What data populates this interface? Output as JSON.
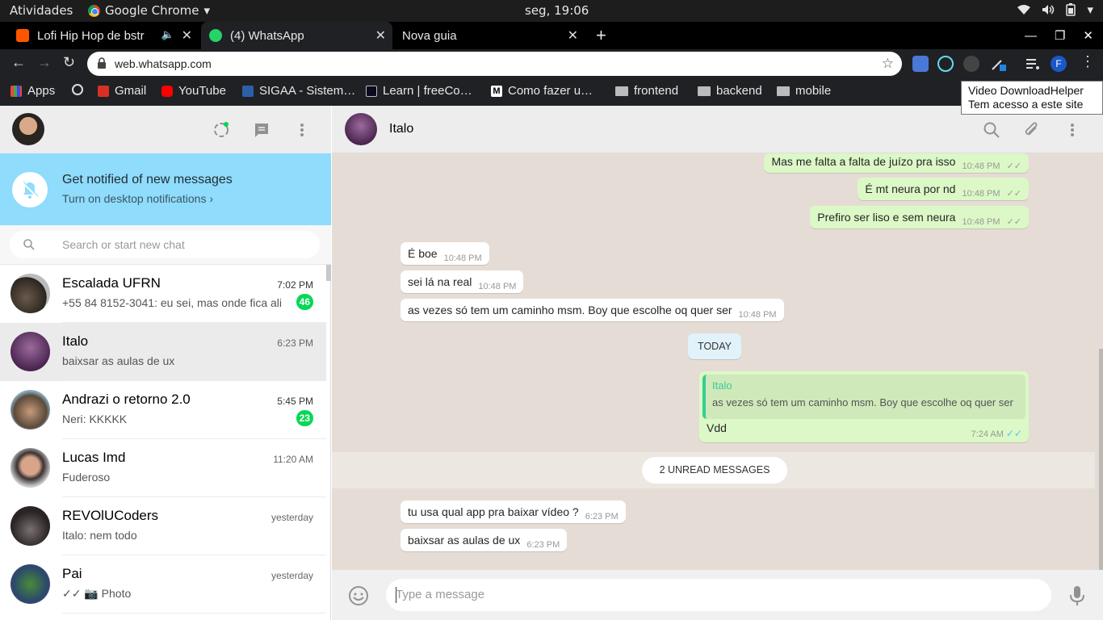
{
  "os": {
    "activities": "Atividades",
    "app_name": "Google Chrome",
    "app_menu_arrow": "▾",
    "clock": "seg, 19:06"
  },
  "tabs": [
    {
      "title": "Lofi Hip Hop de bstr",
      "audio": "🔈",
      "close": "✕",
      "favicon_color": "#ff5500"
    },
    {
      "title": "(4) WhatsApp",
      "close": "✕",
      "favicon_color": "#25d366"
    },
    {
      "title": "Nova guia",
      "close": "✕"
    }
  ],
  "new_tab": "+",
  "window_controls": {
    "minimize": "—",
    "maximize": "❐",
    "close": "✕"
  },
  "toolbar": {
    "back": "←",
    "forward": "→",
    "reload": "↻",
    "url": "web.whatsapp.com",
    "star": "☆",
    "profile_letter": "F",
    "menu": "⋮"
  },
  "bookmarks": [
    {
      "label": "Apps",
      "icon": "apps-grid-icon"
    },
    {
      "label": "",
      "icon": "globe-icon"
    },
    {
      "label": "Gmail",
      "icon": "gmail-icon"
    },
    {
      "label": "YouTube",
      "icon": "youtube-icon"
    },
    {
      "label": "SIGAA - Sistem…",
      "icon": "sigaa-icon"
    },
    {
      "label": "Learn | freeCo…",
      "icon": "freecodecamp-icon"
    },
    {
      "label": "Como fazer u…",
      "icon": "medium-icon"
    },
    {
      "label": "frontend",
      "icon": "folder-icon"
    },
    {
      "label": "backend",
      "icon": "folder-icon"
    },
    {
      "label": "mobile",
      "icon": "folder-icon"
    }
  ],
  "tooltip": {
    "line1": "Video DownloadHelper",
    "line2": "Tem acesso a este site"
  },
  "notify": {
    "title": "Get notified of new messages",
    "subtitle": "Turn on desktop notifications ›"
  },
  "search": {
    "placeholder": "Search or start new chat"
  },
  "chats": [
    {
      "name": "Escalada UFRN",
      "time": "7:02 PM",
      "preview": "+55 84 8152-3041: eu sei, mas onde fica ali",
      "badge": "46",
      "selected": false
    },
    {
      "name": "Italo",
      "time": "6:23 PM",
      "preview": "baixsar as aulas de ux",
      "badge": "",
      "selected": true
    },
    {
      "name": "Andrazi o retorno 2.0",
      "time": "5:45 PM",
      "preview": "Neri: KKKKK",
      "badge": "23",
      "selected": false
    },
    {
      "name": "Lucas Imd",
      "time": "11:20 AM",
      "preview": "Fuderoso",
      "badge": "",
      "selected": false
    },
    {
      "name": "REVOlUCoders",
      "time": "yesterday",
      "preview": "Italo: nem todo",
      "badge": "",
      "selected": false
    },
    {
      "name": "Pai",
      "time": "yesterday",
      "preview": "✓✓ 📷 Photo",
      "badge": "",
      "selected": false
    }
  ],
  "conversation": {
    "contact": "Italo",
    "messages": [
      {
        "dir": "out",
        "text": "Mas me falta a falta de juízo pra isso",
        "time": "10:48 PM",
        "ticks": "✓✓"
      },
      {
        "dir": "out",
        "text": "É mt neura por nd",
        "time": "10:48 PM",
        "ticks": "✓✓"
      },
      {
        "dir": "out",
        "text": "Prefiro ser liso e sem neura",
        "time": "10:48 PM",
        "ticks": "✓✓"
      },
      {
        "dir": "in",
        "text": "É boe",
        "time": "10:48 PM"
      },
      {
        "dir": "in",
        "text": "sei lá na real",
        "time": "10:48 PM"
      },
      {
        "dir": "in",
        "text": "as vezes só tem um caminho msm. Boy que escolhe oq quer ser",
        "time": "10:48 PM"
      },
      {
        "dir": "in",
        "text": "tu usa qual app pra baixar vídeo ?",
        "time": "6:23 PM"
      },
      {
        "dir": "in",
        "text": "baixsar as aulas de ux",
        "time": "6:23 PM"
      }
    ],
    "day_label": "TODAY",
    "quoted": {
      "author": "Italo",
      "text": "as vezes só tem um caminho msm. Boy que escolhe oq quer ser",
      "reply": "Vdd",
      "time": "7:24 AM",
      "ticks": "✓✓"
    },
    "unread_label": "2 UNREAD MESSAGES"
  },
  "compose": {
    "placeholder": "Type a message"
  },
  "colors": {
    "accent_green": "#06d755",
    "outgoing_bubble": "#dcf8c6",
    "notify_banner": "#8fdcfc",
    "read_ticks": "#4fc3f7"
  }
}
